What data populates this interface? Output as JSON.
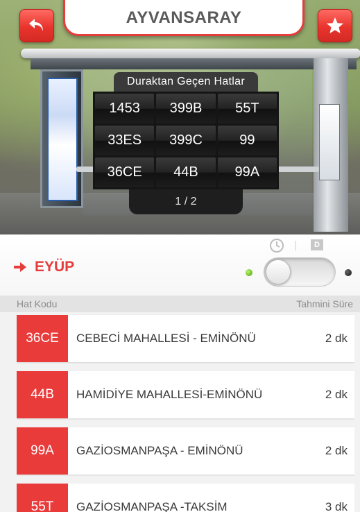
{
  "header": {
    "title": "AYVANSARAY",
    "back_icon": "back-arrow-icon",
    "favorite_icon": "star-icon",
    "accent_color": "#e53c3c"
  },
  "board": {
    "heading": "Duraktan Geçen Hatlar",
    "lines": [
      "1453",
      "399B",
      "55T",
      "33ES",
      "399C",
      "99",
      "36CE",
      "44B",
      "99A"
    ],
    "page_indicator": "1 / 2"
  },
  "direction": {
    "label": "EYÜP",
    "arrow_icon": "right-arrow-icon",
    "clock_icon": "clock-icon",
    "d_badge": "D"
  },
  "columns": {
    "code": "Hat Kodu",
    "eta": "Tahmini Süre"
  },
  "routes": [
    {
      "code": "36CE",
      "name": "CEBECİ MAHALLESİ - EMİNÖNÜ",
      "time": "2 dk"
    },
    {
      "code": "44B",
      "name": "HAMİDİYE MAHALLESİ-EMİNÖNÜ",
      "time": "2 dk"
    },
    {
      "code": "99A",
      "name": "GAZİOSMANPAŞA - EMİNÖNÜ",
      "time": "2 dk"
    },
    {
      "code": "55T",
      "name": "GAZİOSMANPAŞA -TAKSİM",
      "time": "3 dk"
    }
  ]
}
